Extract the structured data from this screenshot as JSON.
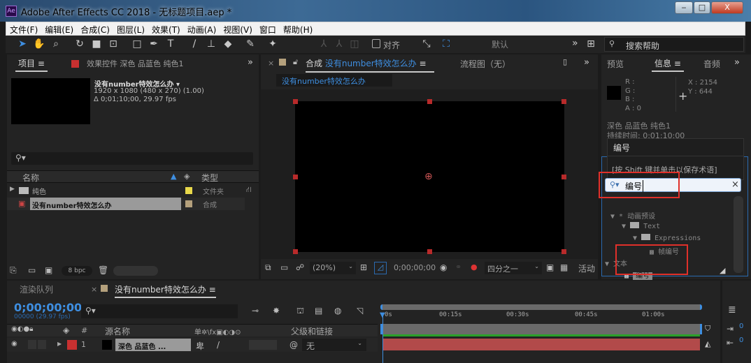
{
  "window": {
    "title": "Adobe After Effects CC 2018 - 无标题项目.aep *",
    "logo": "Ae",
    "minimize": "‒",
    "maximize": "□",
    "close": "X"
  },
  "menu": [
    "文件(F)",
    "编辑(E)",
    "合成(C)",
    "图层(L)",
    "效果(T)",
    "动画(A)",
    "视图(V)",
    "窗口",
    "帮助(H)"
  ],
  "toolbar": {
    "snap_label": "对齐",
    "workspace": "默认",
    "more": "»",
    "search_placeholder": "搜索帮助"
  },
  "project": {
    "tab_label": "项目",
    "effects_tab": "效果控件 深色 品蓝色 纯色1",
    "comp_name": "没有number特效怎么办",
    "resolution": "1920 x 1080  (480 x 270) (1.00)",
    "duration": "Δ 0;01;10;00, 29.97 fps",
    "col_name": "名称",
    "col_type": "类型",
    "items": [
      {
        "name": "纯色",
        "type": "文件夹",
        "color": "#e8d84a"
      },
      {
        "name": "没有number特效怎么办",
        "type": "合成",
        "color": "#b4a07c"
      }
    ],
    "bpc": "8 bpc"
  },
  "comp": {
    "tab_prefix": "合成",
    "tab_name": "没有number特效怎么办",
    "flowchart": "流程图（无）",
    "breadcrumb": "没有number特效怎么办",
    "zoom": "(20%)",
    "timecode": "0;00;00;00",
    "resolution": "四分之一",
    "active_camera": "活动"
  },
  "info": {
    "tab_preview": "预览",
    "tab_info": "信息",
    "tab_audio": "音频",
    "r": "R :",
    "g": "G :",
    "b": "B :",
    "a": "A : 0",
    "x": "X : 2154",
    "y": "Y : 644",
    "layer": "深色 品蓝色 纯色1",
    "duration": "持续时间: 0:01:10:00"
  },
  "effects": {
    "suggest_term": "编号",
    "suggest_hint": "[按 Shift 键并单击以保存术语]",
    "search_value": "编号",
    "tree": [
      {
        "label": "* 动画预设",
        "level": 0
      },
      {
        "label": "Text",
        "level": 1
      },
      {
        "label": "Expressions",
        "level": 2
      },
      {
        "label": "帧编号",
        "level": 3
      },
      {
        "label": "文本",
        "level": 0
      },
      {
        "label": "编号",
        "level": 1
      }
    ]
  },
  "timeline": {
    "render_tab": "渲染队列",
    "comp_tab": "没有number特效怎么办",
    "timecode": "0;00;00;00",
    "frames": "00000 (29.97 fps)",
    "col_num": "#",
    "col_source": "源名称",
    "col_switches": "单✲\\fx▣◐◑⊙",
    "col_parent": "父级和链接",
    "ruler": [
      "0s",
      "00:15s",
      "00:30s",
      "00:45s",
      "01:00s"
    ],
    "layer": {
      "index": "1",
      "name": "深色 品蓝色 ...",
      "parent": "无"
    },
    "right_vals": [
      "0",
      "0"
    ]
  }
}
